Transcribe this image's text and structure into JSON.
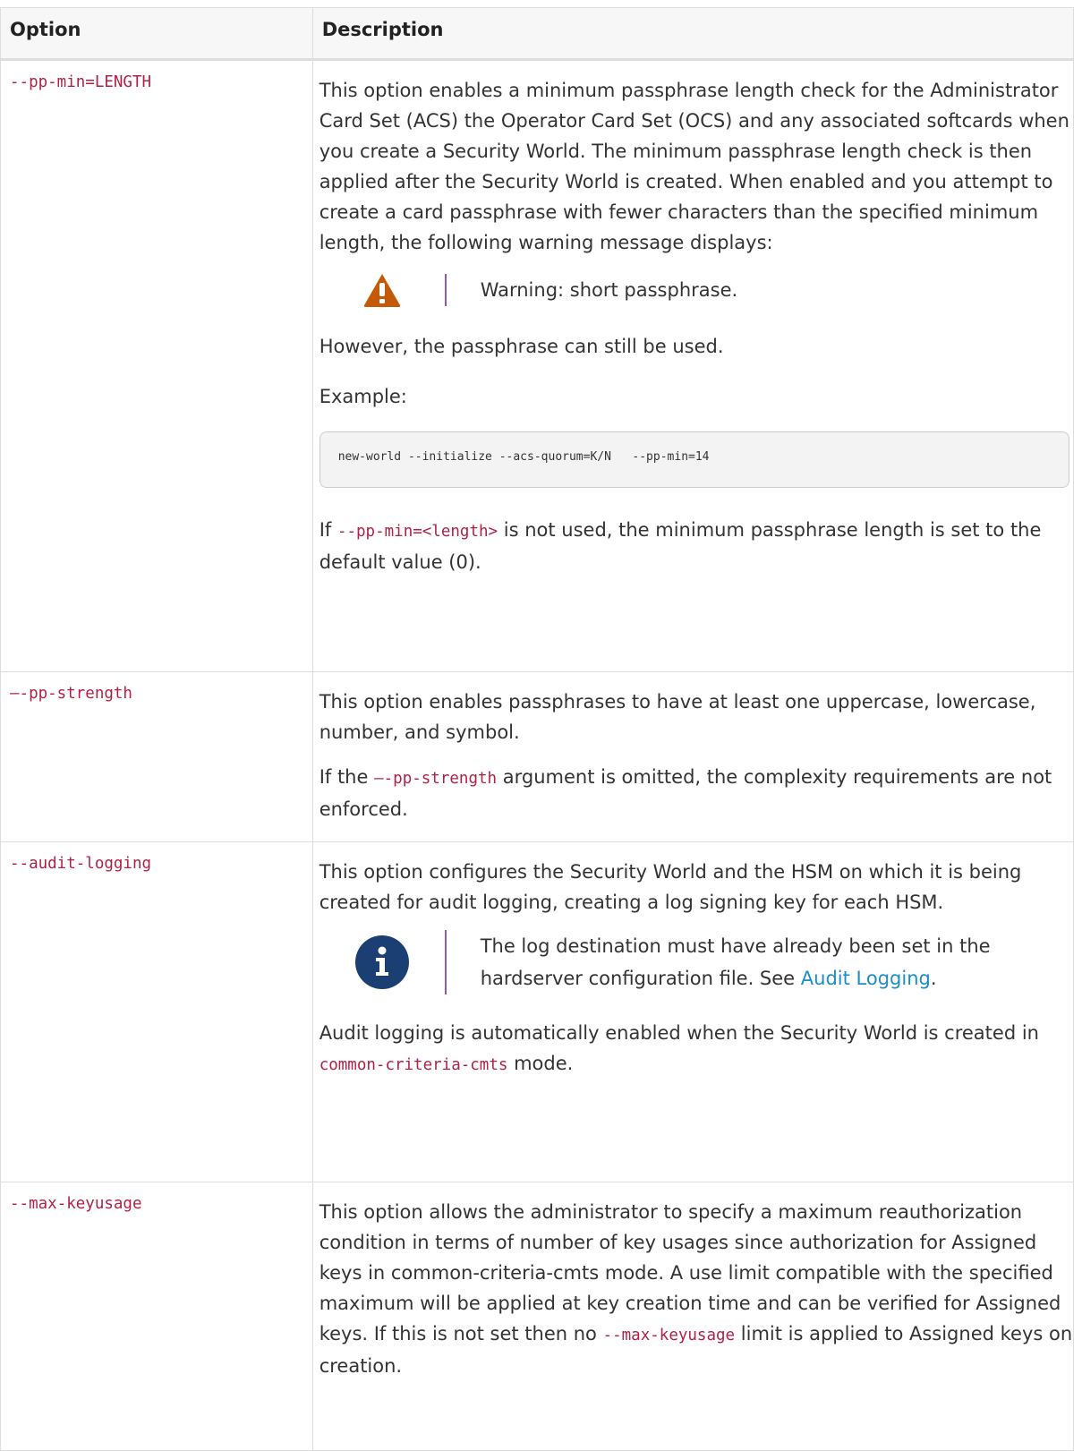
{
  "headers": {
    "option": "Option",
    "description": "Description"
  },
  "rows": [
    {
      "option": "--pp-min=LENGTH",
      "p1": "This option enables a minimum passphrase length check for the Administrator Card Set (ACS) the Operator Card Set (OCS) and any associated softcards when you create a Security World. The minimum passphrase length check is then applied after the Security World is created. When enabled and you attempt to create a card passphrase with fewer characters than the specified minimum length, the following warning message displays:",
      "warning_text": "Warning: short passphrase.",
      "p2": "However, the passphrase can still be used.",
      "p3": "Example:",
      "code": "new-world --initialize --acs-quorum=K/N   --pp-min=14",
      "p4_before": "If ",
      "p4_code": "--pp-min=<length>",
      "p4_after": " is not used, the minimum passphrase length is set to the default value (0)."
    },
    {
      "option": "—-pp-strength",
      "p1": "This option enables passphrases to have at least one uppercase, lowercase, number, and symbol.",
      "p2_before": "If the ",
      "p2_code": "—-pp-strength",
      "p2_after": " argument is omitted, the complexity requirements are not enforced."
    },
    {
      "option": "--audit-logging",
      "p1": "This option configures the Security World and the HSM on which it is being created for audit logging, creating a log signing key for each HSM.",
      "note_before": "The log destination must have already been set in the hardserver configuration file. See ",
      "note_link": "Audit Logging",
      "note_after": ".",
      "p2_before": "Audit logging is automatically enabled when the Security World is created in ",
      "p2_code": "common-criteria-cmts",
      "p2_after": " mode."
    },
    {
      "option": "--max-keyusage",
      "p1_before": "This option allows the administrator to specify a maximum reauthorization condition in terms of number of key usages since authorization for Assigned keys in common-criteria-cmts mode. A use limit compatible with the specified maximum will be applied at key creation time and can be verified for Assigned keys. If this is not set then no ",
      "p1_code": "--max-keyusage",
      "p1_after": " limit is applied to Assigned keys on creation."
    }
  ],
  "icons": {
    "warning": "warning-triangle-icon",
    "info": "info-circle-icon"
  },
  "colors": {
    "code": "#b12146",
    "link": "#1a8ec7",
    "warning": "#c45a06",
    "info": "#1b3f73",
    "admonition_bar": "#8e5bb0"
  }
}
